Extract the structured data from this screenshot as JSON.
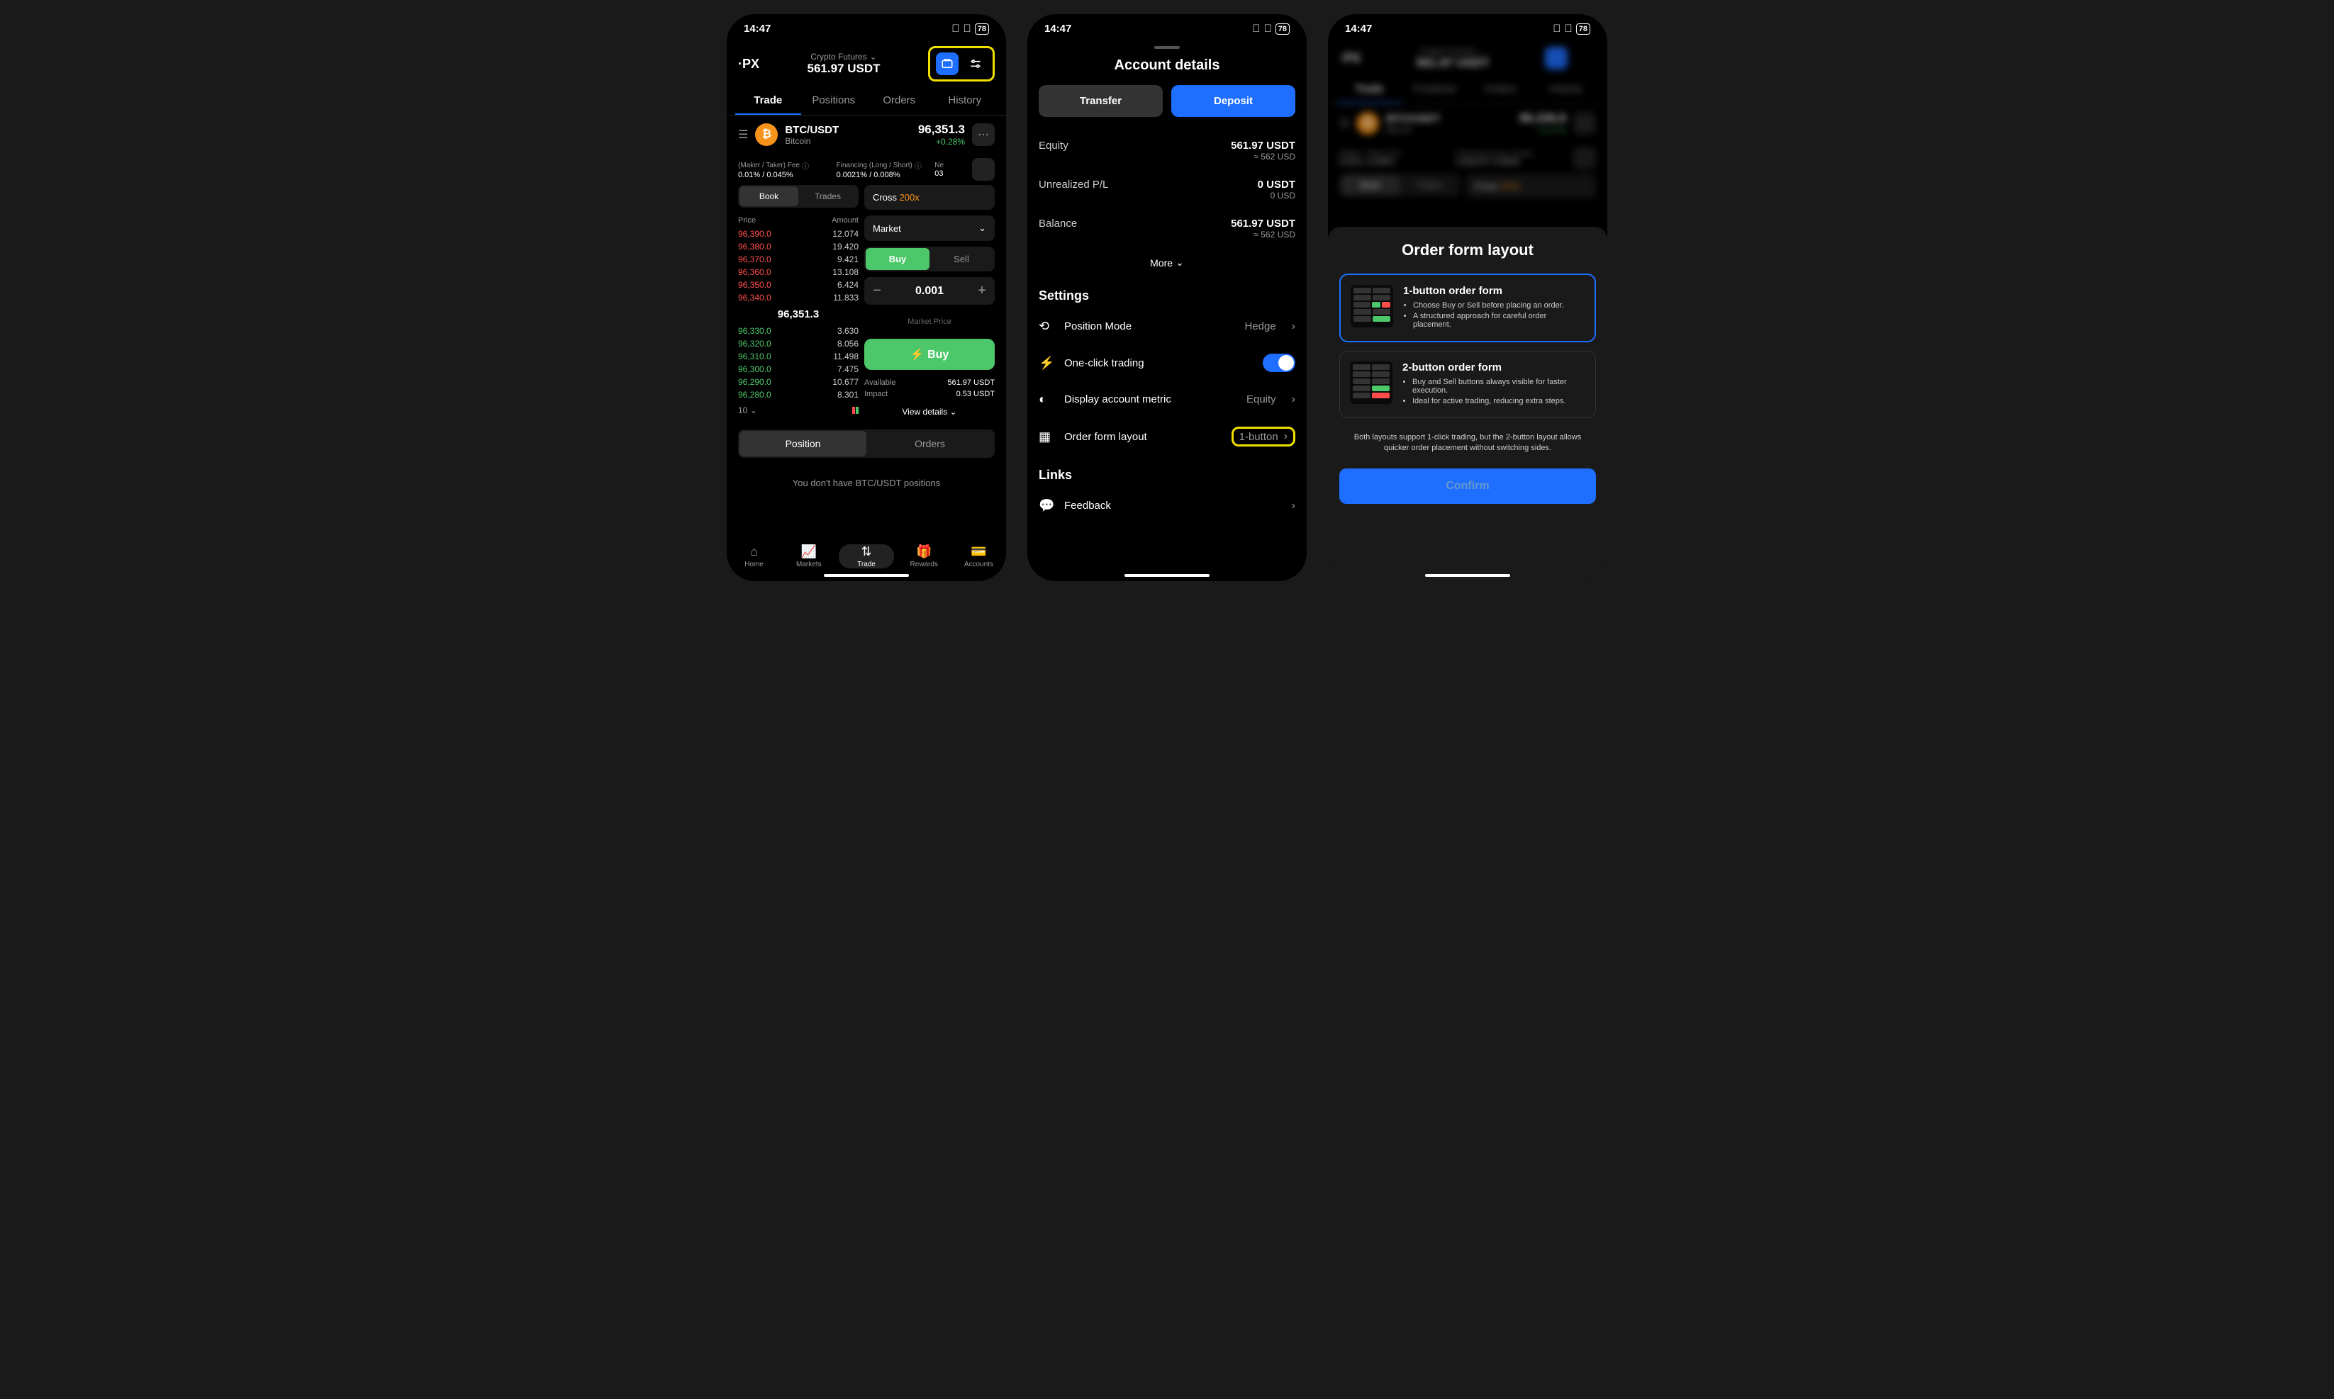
{
  "status": {
    "time": "14:47",
    "battery": "78"
  },
  "screen1": {
    "logo": "·PX",
    "market_type": "Crypto Futures",
    "balance": "561.97 USDT",
    "tabs": [
      "Trade",
      "Positions",
      "Orders",
      "History"
    ],
    "pair": {
      "symbol": "BTC/USDT",
      "name": "Bitcoin",
      "price": "96,351.3",
      "change": "+0.28%"
    },
    "fees": {
      "maker_label": "(Maker / Taker) Fee",
      "maker_val": "0.01% / 0.045%",
      "fin_label": "Financing (Long / Short)",
      "fin_val": "0.0021% / 0.008%",
      "next_label": "Ne",
      "next_val": "03"
    },
    "book_trades": [
      "Book",
      "Trades"
    ],
    "margin": {
      "mode": "Cross",
      "lev": "200x"
    },
    "ob_headers": [
      "Price",
      "Amount"
    ],
    "order_type": "Market",
    "asks": [
      {
        "p": "96,390.0",
        "a": "12.074"
      },
      {
        "p": "96,380.0",
        "a": "19.420"
      },
      {
        "p": "96,370.0",
        "a": "9.421"
      },
      {
        "p": "96,360.0",
        "a": "13.108"
      },
      {
        "p": "96,350.0",
        "a": "6.424"
      },
      {
        "p": "96,340.0",
        "a": "11.833"
      }
    ],
    "mid": "96,351.3",
    "bids": [
      {
        "p": "96,330.0",
        "a": "3.630"
      },
      {
        "p": "96,320.0",
        "a": "8.056"
      },
      {
        "p": "96,310.0",
        "a": "11.498"
      },
      {
        "p": "96,300.0",
        "a": "7.475"
      },
      {
        "p": "96,290.0",
        "a": "10.677"
      },
      {
        "p": "96,280.0",
        "a": "8.301"
      }
    ],
    "group": "10",
    "side": {
      "buy": "Buy",
      "sell": "Sell"
    },
    "qty": "0.001",
    "market_price": "Market Price",
    "buy_btn": "⚡ Buy",
    "available": {
      "label": "Available",
      "val": "561.97 USDT"
    },
    "impact": {
      "label": "Impact",
      "val": "0.53 USDT"
    },
    "view_details": "View details",
    "pos_orders": [
      "Position",
      "Orders"
    ],
    "empty": "You don't have BTC/USDT positions",
    "nav": [
      "Home",
      "Markets",
      "Trade",
      "Rewards",
      "Accounts"
    ]
  },
  "screen2": {
    "title": "Account details",
    "transfer": "Transfer",
    "deposit": "Deposit",
    "rows": [
      {
        "label": "Equity",
        "main": "561.97 USDT",
        "sub": "≈ 562 USD"
      },
      {
        "label": "Unrealized P/L",
        "main": "0 USDT",
        "sub": "0 USD"
      },
      {
        "label": "Balance",
        "main": "561.97 USDT",
        "sub": "≈ 562 USD"
      }
    ],
    "more": "More",
    "settings_title": "Settings",
    "settings": [
      {
        "label": "Position Mode",
        "val": "Hedge"
      },
      {
        "label": "One-click trading",
        "toggle": true
      },
      {
        "label": "Display account metric",
        "val": "Equity"
      },
      {
        "label": "Order form layout",
        "val": "1-button",
        "highlight": true
      }
    ],
    "links_title": "Links",
    "feedback": "Feedback"
  },
  "screen3": {
    "bg_pair": {
      "symbol": "BTC/USDT",
      "name": "Bitcoin",
      "price": "96,336.8",
      "change": "+0.27%"
    },
    "modal_title": "Order form layout",
    "opt1": {
      "title": "1-button order form",
      "bullets": [
        "Choose Buy or Sell before placing an order.",
        "A structured approach for careful order placement."
      ]
    },
    "opt2": {
      "title": "2-button order form",
      "bullets": [
        "Buy and Sell buttons always visible for faster execution.",
        "Ideal for active trading, reducing extra steps."
      ]
    },
    "footnote": "Both layouts support 1-click trading, but the 2-button layout allows quicker order placement without switching sides.",
    "confirm": "Confirm"
  }
}
